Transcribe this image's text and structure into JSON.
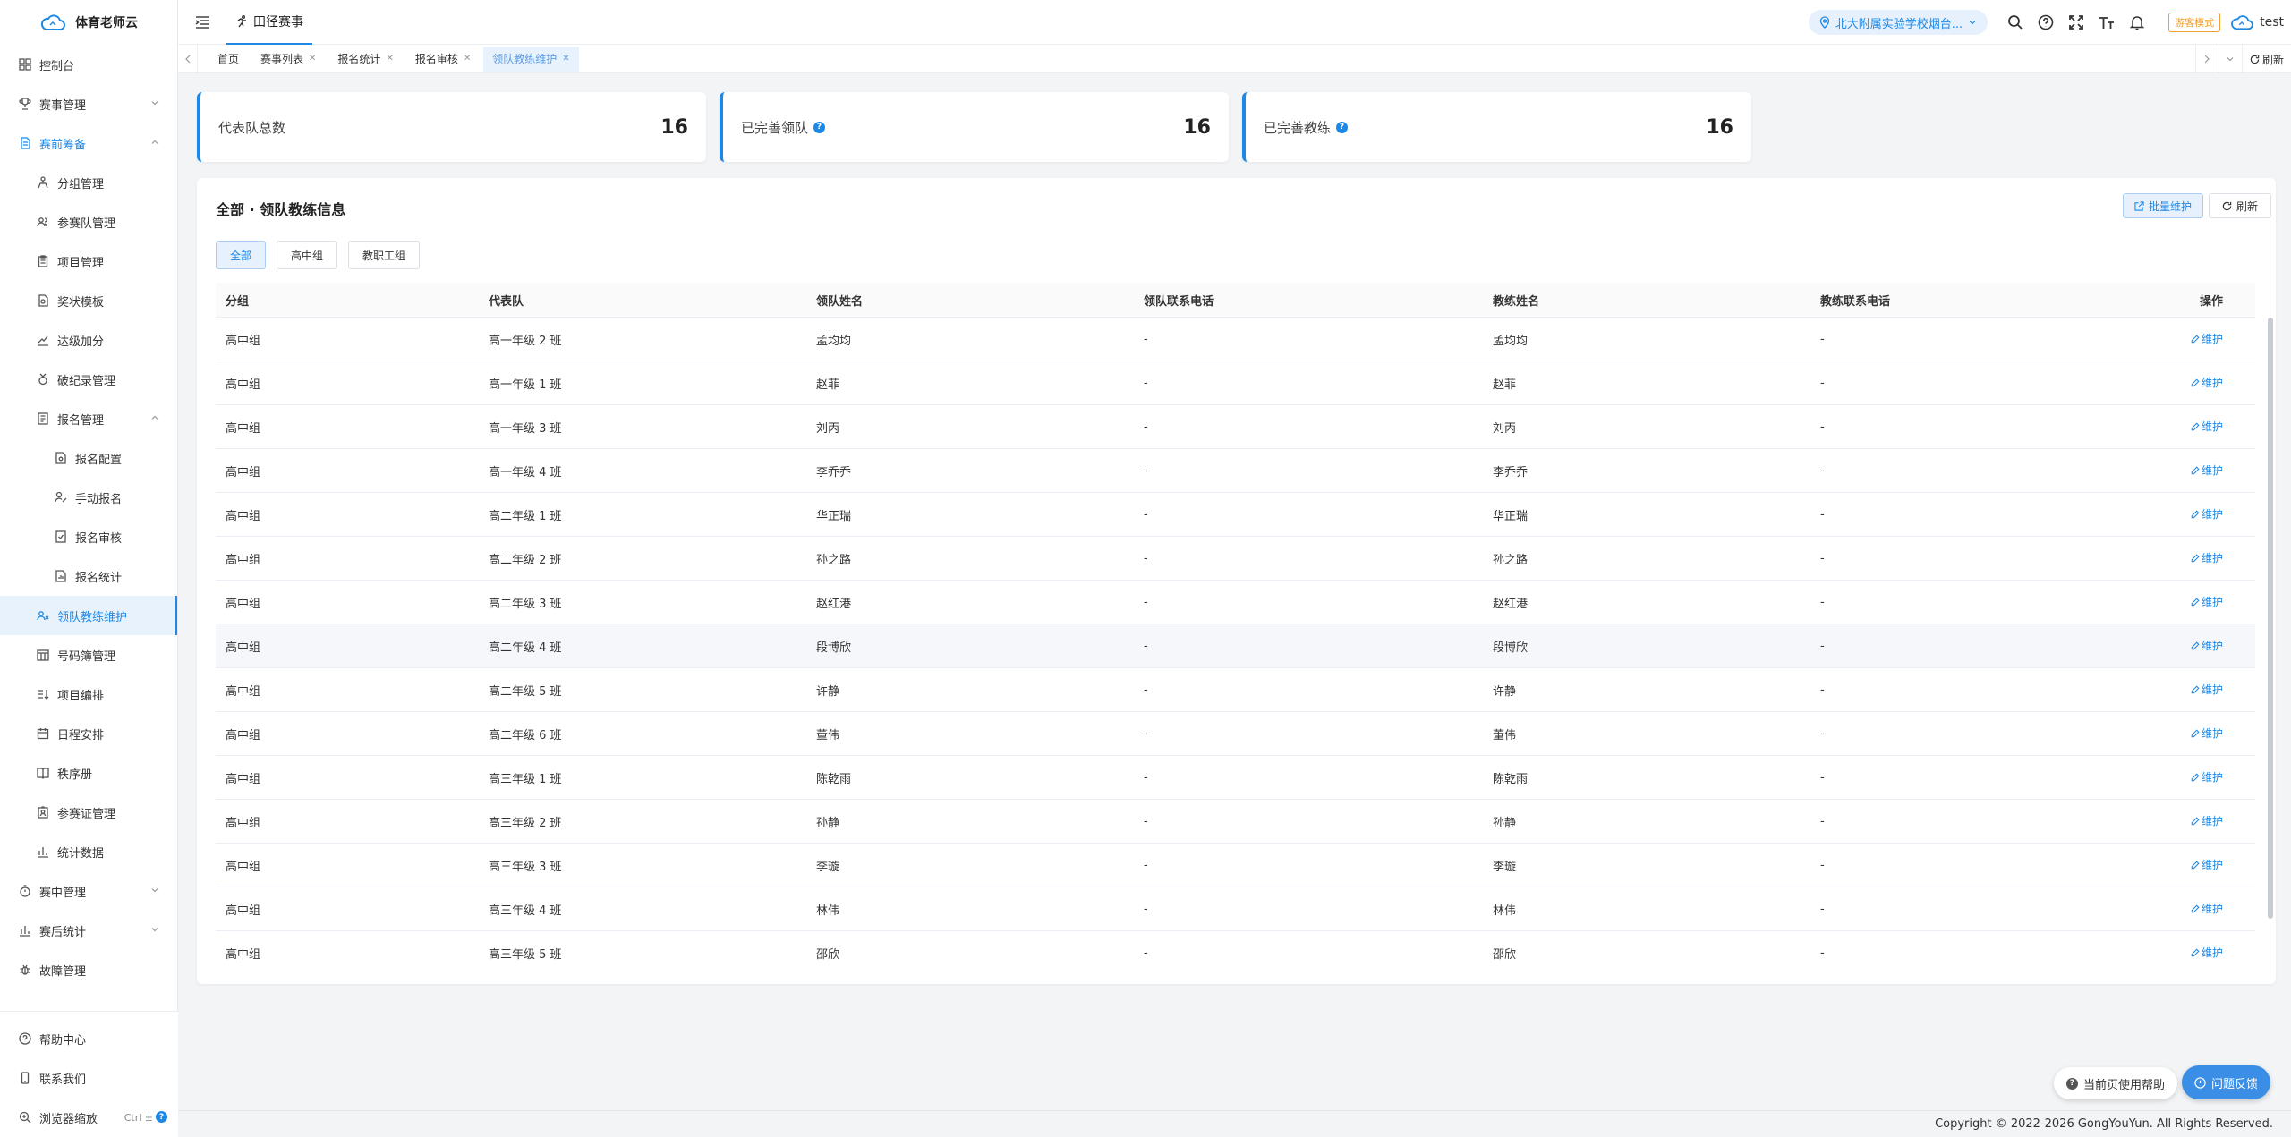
{
  "app": {
    "title": "体育老师云"
  },
  "sidebar": {
    "items": [
      {
        "label": "控制台"
      },
      {
        "label": "赛事管理"
      },
      {
        "label": "赛前筹备"
      },
      {
        "label": "分组管理"
      },
      {
        "label": "参赛队管理"
      },
      {
        "label": "项目管理"
      },
      {
        "label": "奖状模板"
      },
      {
        "label": "达级加分"
      },
      {
        "label": "破纪录管理"
      },
      {
        "label": "报名管理"
      },
      {
        "label": "报名配置"
      },
      {
        "label": "手动报名"
      },
      {
        "label": "报名审核"
      },
      {
        "label": "报名统计"
      },
      {
        "label": "领队教练维护"
      },
      {
        "label": "号码簿管理"
      },
      {
        "label": "项目编排"
      },
      {
        "label": "日程安排"
      },
      {
        "label": "秩序册"
      },
      {
        "label": "参赛证管理"
      },
      {
        "label": "统计数据"
      },
      {
        "label": "赛中管理"
      },
      {
        "label": "赛后统计"
      },
      {
        "label": "故障管理"
      }
    ],
    "bottom": {
      "help": "帮助中心",
      "contact": "联系我们",
      "zoom": "浏览器缩放",
      "zoom_hint": "Ctrl ±"
    }
  },
  "topbar": {
    "module": "田径赛事",
    "school": "北大附属实验学校烟台...",
    "guest_mode": "游客模式",
    "username": "test"
  },
  "tabs": {
    "items": [
      "首页",
      "赛事列表",
      "报名统计",
      "报名审核",
      "领队教练维护"
    ],
    "refresh": "刷新"
  },
  "stats": [
    {
      "label": "代表队总数",
      "value": "16"
    },
    {
      "label": "已完善领队",
      "value": "16"
    },
    {
      "label": "已完善教练",
      "value": "16"
    }
  ],
  "panel": {
    "title": "全部 · 领队教练信息",
    "batch_button": "批量维护",
    "refresh_button": "刷新",
    "filters": [
      "全部",
      "高中组",
      "教职工组"
    ]
  },
  "table": {
    "headers": [
      "分组",
      "代表队",
      "领队姓名",
      "领队联系电话",
      "教练姓名",
      "教练联系电话",
      "操作"
    ],
    "action_label": "维护",
    "rows": [
      [
        "高中组",
        "高一年级 2 班",
        "孟均均",
        "-",
        "孟均均",
        "-"
      ],
      [
        "高中组",
        "高一年级 1 班",
        "赵菲",
        "-",
        "赵菲",
        "-"
      ],
      [
        "高中组",
        "高一年级 3 班",
        "刘丙",
        "-",
        "刘丙",
        "-"
      ],
      [
        "高中组",
        "高一年级 4 班",
        "李乔乔",
        "-",
        "李乔乔",
        "-"
      ],
      [
        "高中组",
        "高二年级 1 班",
        "华正瑞",
        "-",
        "华正瑞",
        "-"
      ],
      [
        "高中组",
        "高二年级 2 班",
        "孙之路",
        "-",
        "孙之路",
        "-"
      ],
      [
        "高中组",
        "高二年级 3 班",
        "赵红港",
        "-",
        "赵红港",
        "-"
      ],
      [
        "高中组",
        "高二年级 4 班",
        "段博欣",
        "-",
        "段博欣",
        "-"
      ],
      [
        "高中组",
        "高二年级 5 班",
        "许静",
        "-",
        "许静",
        "-"
      ],
      [
        "高中组",
        "高二年级 6 班",
        "董伟",
        "-",
        "董伟",
        "-"
      ],
      [
        "高中组",
        "高三年级 1 班",
        "陈乾雨",
        "-",
        "陈乾雨",
        "-"
      ],
      [
        "高中组",
        "高三年级 2 班",
        "孙静",
        "-",
        "孙静",
        "-"
      ],
      [
        "高中组",
        "高三年级 3 班",
        "李璇",
        "-",
        "李璇",
        "-"
      ],
      [
        "高中组",
        "高三年级 4 班",
        "林伟",
        "-",
        "林伟",
        "-"
      ],
      [
        "高中组",
        "高三年级 5 班",
        "邵欣",
        "-",
        "邵欣",
        "-"
      ]
    ]
  },
  "floating": {
    "page_help": "当前页使用帮助",
    "feedback": "问题反馈"
  },
  "footer": {
    "copyright": "Copyright © 2022-2026 GongYouYun. All Rights Reserved."
  },
  "colors": {
    "accent": "#1e88e5",
    "guest": "#f0a030"
  }
}
